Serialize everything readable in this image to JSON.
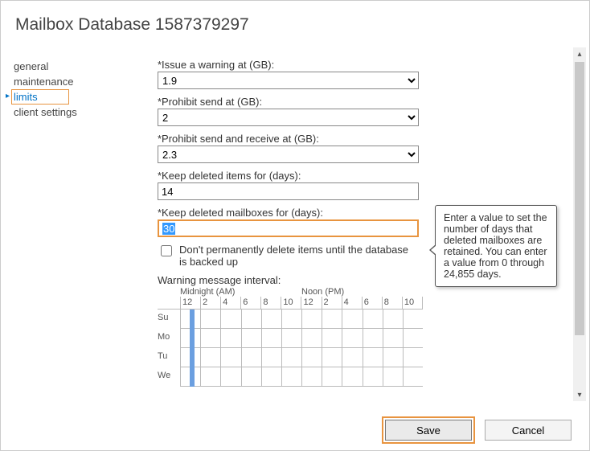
{
  "title": "Mailbox Database 1587379297",
  "sidebar": {
    "items": [
      {
        "label": "general"
      },
      {
        "label": "maintenance"
      },
      {
        "label": "limits"
      },
      {
        "label": "client settings"
      }
    ],
    "active_index": 2
  },
  "form": {
    "warning_label": "*Issue a warning at (GB):",
    "warning_value": "1.9",
    "prohibit_send_label": "*Prohibit send at (GB):",
    "prohibit_send_value": "2",
    "prohibit_sr_label": "*Prohibit send and receive at (GB):",
    "prohibit_sr_value": "2.3",
    "keep_items_label": "*Keep deleted items for (days):",
    "keep_items_value": "14",
    "keep_mbox_label": "*Keep deleted mailboxes for (days):",
    "keep_mbox_value": "30",
    "dont_delete_label": "Don't permanently delete items until the database is backed up",
    "dont_delete_checked": false,
    "interval_label": "Warning message interval:",
    "interval_midnight": "Midnight (AM)",
    "interval_noon": "Noon (PM)",
    "hours": [
      "12",
      "2",
      "4",
      "6",
      "8",
      "10",
      "12",
      "2",
      "4",
      "6",
      "8",
      "10"
    ],
    "days": [
      "Su",
      "Mo",
      "Tu",
      "We"
    ]
  },
  "tooltip": "Enter a value to set the number of days that deleted mailboxes are retained. You can enter a value from 0 through 24,855 days.",
  "footer": {
    "save": "Save",
    "cancel": "Cancel"
  }
}
